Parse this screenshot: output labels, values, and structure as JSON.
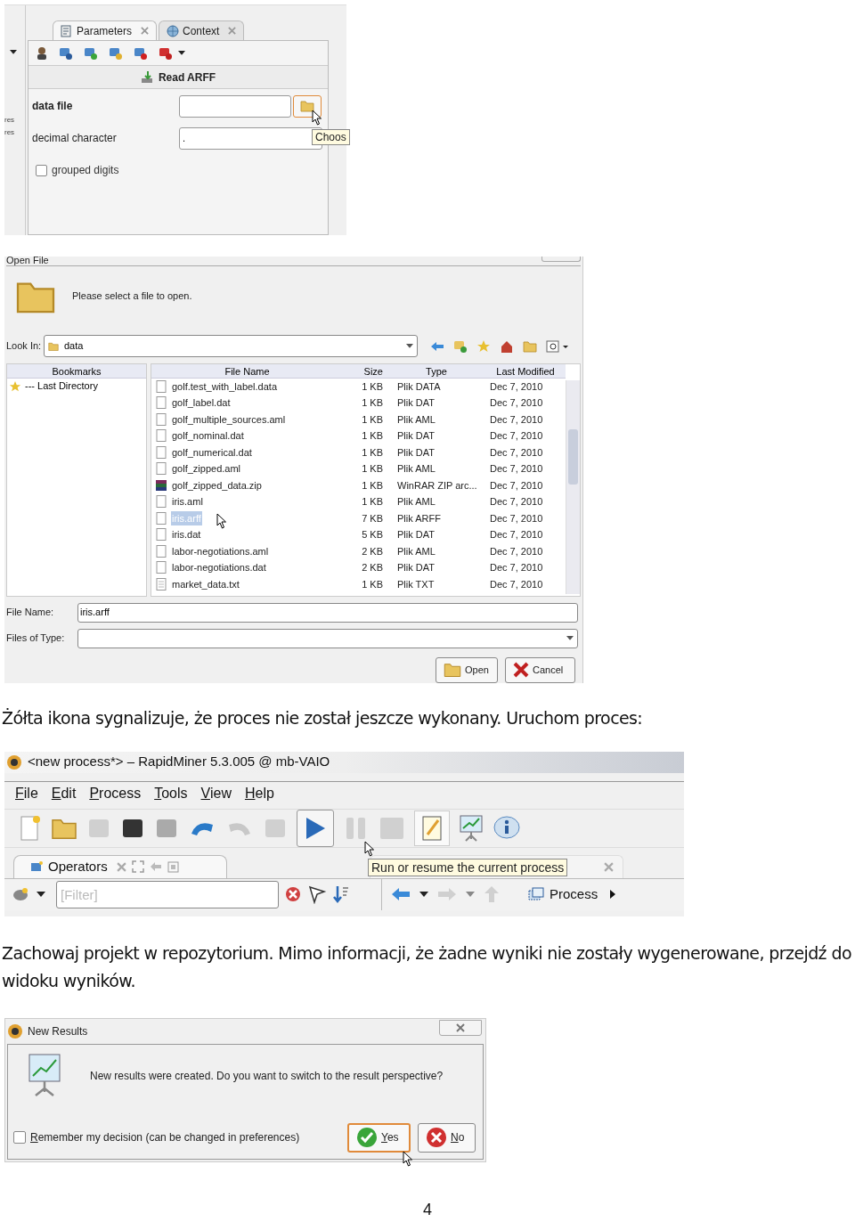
{
  "params_panel": {
    "left_fragments": [
      "res",
      "res"
    ],
    "tabs": [
      {
        "label": "Parameters",
        "selected": true
      },
      {
        "label": "Context",
        "selected": false
      }
    ],
    "operator_title": "Read ARFF",
    "fields": [
      {
        "kind": "file",
        "label": "data file"
      },
      {
        "kind": "text",
        "label": "decimal character",
        "value": "."
      },
      {
        "kind": "checkbox",
        "label": "grouped digits",
        "checked": false
      }
    ],
    "tooltip": "Choos"
  },
  "open_file": {
    "title": "Open File",
    "message": "Please select a file to open.",
    "look_in": {
      "label": "Look In:",
      "value": "data"
    },
    "bookmarks": {
      "header": "Bookmarks",
      "items": [
        "--- Last Directory"
      ]
    },
    "columns": [
      "File Name",
      "Size",
      "Type",
      "Last Modified"
    ],
    "files": [
      {
        "name": "golf.test_with_label.data",
        "size": "1 KB",
        "type": "Plik DATA",
        "modified": "Dec 7, 2010",
        "kind": "doc",
        "selected": false
      },
      {
        "name": "golf_label.dat",
        "size": "1 KB",
        "type": "Plik DAT",
        "modified": "Dec 7, 2010",
        "kind": "doc",
        "selected": false
      },
      {
        "name": "golf_multiple_sources.aml",
        "size": "1 KB",
        "type": "Plik AML",
        "modified": "Dec 7, 2010",
        "kind": "doc",
        "selected": false
      },
      {
        "name": "golf_nominal.dat",
        "size": "1 KB",
        "type": "Plik DAT",
        "modified": "Dec 7, 2010",
        "kind": "doc",
        "selected": false
      },
      {
        "name": "golf_numerical.dat",
        "size": "1 KB",
        "type": "Plik DAT",
        "modified": "Dec 7, 2010",
        "kind": "doc",
        "selected": false
      },
      {
        "name": "golf_zipped.aml",
        "size": "1 KB",
        "type": "Plik AML",
        "modified": "Dec 7, 2010",
        "kind": "doc",
        "selected": false
      },
      {
        "name": "golf_zipped_data.zip",
        "size": "1 KB",
        "type": "WinRAR ZIP arc...",
        "modified": "Dec 7, 2010",
        "kind": "archive",
        "selected": false
      },
      {
        "name": "iris.aml",
        "size": "1 KB",
        "type": "Plik AML",
        "modified": "Dec 7, 2010",
        "kind": "doc",
        "selected": false
      },
      {
        "name": "iris.arff",
        "size": "7 KB",
        "type": "Plik ARFF",
        "modified": "Dec 7, 2010",
        "kind": "doc",
        "selected": true
      },
      {
        "name": "iris.dat",
        "size": "5 KB",
        "type": "Plik DAT",
        "modified": "Dec 7, 2010",
        "kind": "doc",
        "selected": false
      },
      {
        "name": "labor-negotiations.aml",
        "size": "2 KB",
        "type": "Plik AML",
        "modified": "Dec 7, 2010",
        "kind": "doc",
        "selected": false
      },
      {
        "name": "labor-negotiations.dat",
        "size": "2 KB",
        "type": "Plik DAT",
        "modified": "Dec 7, 2010",
        "kind": "doc",
        "selected": false
      },
      {
        "name": "market_data.txt",
        "size": "1 KB",
        "type": "Plik TXT",
        "modified": "Dec 7, 2010",
        "kind": "text",
        "selected": false
      }
    ],
    "file_name": {
      "label": "File Name:",
      "value": "iris.arff"
    },
    "files_of_type": {
      "label": "Files of Type:"
    },
    "buttons": [
      {
        "label": "Open",
        "kind": "open"
      },
      {
        "label": "Cancel",
        "kind": "cancel"
      }
    ]
  },
  "paragraph_1": "Żółta ikona sygnalizuje, że proces nie został jeszcze wykonany. Uruchom proces:",
  "rapidminer": {
    "title": "<new process*> – RapidMiner 5.3.005 @ mb-VAIO",
    "menu": [
      "File",
      "Edit",
      "Process",
      "Tools",
      "View",
      "Help"
    ],
    "tooltip": "Run or resume the current process",
    "operators_tab": "Operators",
    "filter_placeholder": "[Filter]",
    "process_label": "Process"
  },
  "paragraph_2": "Zachowaj projekt w repozytorium. Mimo informacji, że żadne wyniki nie zostały wygenerowane, przejdź do widoku wyników.",
  "new_results": {
    "title": "New Results",
    "message": "New results were created. Do you want to switch to the result perspective?",
    "remember": {
      "label": "Remember my decision (can be changed in preferences)",
      "checked": false
    },
    "buttons": [
      {
        "label": "Yes",
        "kind": "yes",
        "focused": true
      },
      {
        "label": "No",
        "kind": "no",
        "focused": false
      }
    ]
  },
  "page_number": "4"
}
